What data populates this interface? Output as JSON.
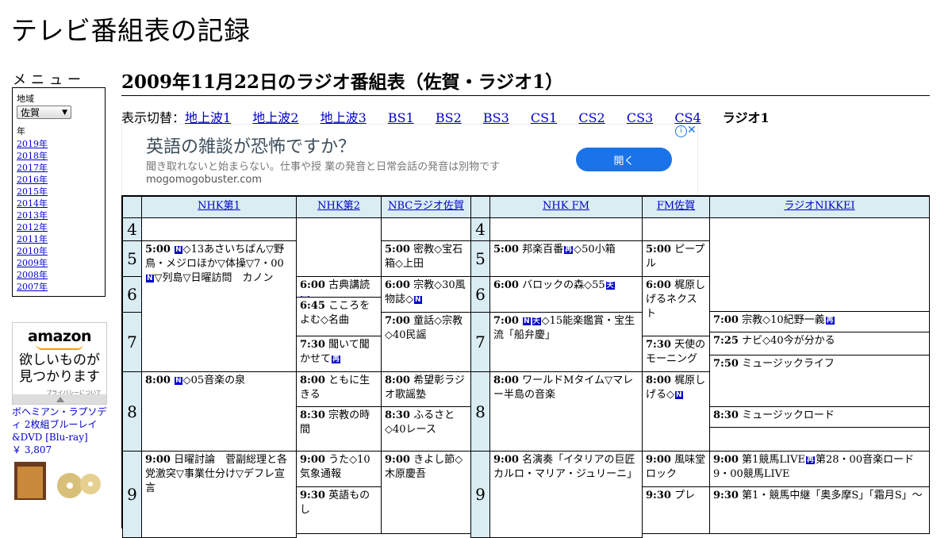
{
  "site": {
    "title": "テレビ番組表の記録"
  },
  "sidebar": {
    "menu_heading": "メニュー",
    "region_label": "地域",
    "region_value": "佐賀",
    "year_label": "年",
    "years": [
      "2019年",
      "2018年",
      "2017年",
      "2016年",
      "2015年",
      "2014年",
      "2013年",
      "2012年",
      "2011年",
      "2010年",
      "2009年",
      "2008年",
      "2007年"
    ]
  },
  "amazon_ad": {
    "logo": "amazon",
    "copy_line1": "欲しいものが",
    "copy_line2": "見つかります",
    "privacy": "プライバシーについて",
    "product_title": "ボヘミアン・ラプソディ 2枚組ブルーレイ&DVD [Blu-ray]",
    "product_price": "￥ 3,807"
  },
  "page": {
    "title": "2009年11月22日のラジオ番組表（佐賀・ラジオ1）"
  },
  "switcher": {
    "label": "表示切替：",
    "links": [
      "地上波1",
      "地上波2",
      "地上波3",
      "BS1",
      "BS2",
      "BS3",
      "CS1",
      "CS2",
      "CS3",
      "CS4"
    ],
    "current": "ラジオ1"
  },
  "banner_ad": {
    "headline": "英語の雑談が恐怖ですか？",
    "description": "聞き取れないと始まらない。仕事や授 業の発音と日常会話の発音は別物です",
    "domain": "mogomogobuster.com",
    "button": "開く",
    "info_icon": "i",
    "close_icon": "✕"
  },
  "schedule": {
    "channels": [
      "NHK第1",
      "NHK第2",
      "NBCラジオ佐賀",
      "NHK FM",
      "FM佐賀",
      "ラジオNIKKEI"
    ],
    "hours": [
      "4",
      "5",
      "6",
      "7",
      "8",
      "9"
    ],
    "programs": {
      "nhk1_500": {
        "time": "5:00",
        "text": "◇13あさいちばん▽野鳥・メジロほか▽体操▽7・00",
        "tail": "▽列島▽日曜訪問　カノン"
      },
      "nhk1_800": {
        "time": "8:00",
        "text": "◇05音楽の泉"
      },
      "nhk1_900": {
        "time": "9:00",
        "text": "日曜討論　菅副総理と各党激突▽事業仕分け▽デフレ宣言"
      },
      "nhk2_600": {
        "time": "6:00",
        "text": "古典講読"
      },
      "nhk2_645": {
        "time": "6:45",
        "text": "こころをよむ◇名曲"
      },
      "nhk2_730": {
        "time": "7:30",
        "text": "聞いて聞かせて"
      },
      "nhk2_800": {
        "time": "8:00",
        "text": "ともに生きる"
      },
      "nhk2_830": {
        "time": "8:30",
        "text": "宗教の時間"
      },
      "nhk2_900": {
        "time": "9:00",
        "text": "うた◇10気象通報"
      },
      "nhk2_930": {
        "time": "9:30",
        "text": "英語ものし"
      },
      "nbc_500": {
        "time": "5:00",
        "text": "密教◇宝石箱◇上田"
      },
      "nbc_600": {
        "time": "6:00",
        "text": "宗教◇30風物誌◇"
      },
      "nbc_700": {
        "time": "7:00",
        "text": "童話◇宗教◇40民謡"
      },
      "nbc_800": {
        "time": "8:00",
        "text": "希望彰ラジオ歌謡塾"
      },
      "nbc_830": {
        "time": "8:30",
        "text": "ふるさと◇40レース"
      },
      "nbc_900": {
        "time": "9:00",
        "text": "きよし節◇木原慶吾"
      },
      "fm_500": {
        "time": "5:00",
        "text": "邦楽百番",
        "tail": "◇50小箱"
      },
      "fm_600": {
        "time": "6:00",
        "text": "バロックの森◇55"
      },
      "fm_700": {
        "time": "7:00",
        "text": "◇15能楽鑑賞・宝生流「船弁慶」"
      },
      "fm_800": {
        "time": "8:00",
        "text": "ワールドMタイム▽マレー半島の音楽"
      },
      "fm_900": {
        "time": "9:00",
        "text": "名演奏「イタリアの巨匠カルロ・マリア・ジュリーニ」"
      },
      "fmsaga_500": {
        "time": "5:00",
        "text": "ピープル"
      },
      "fmsaga_600": {
        "time": "6:00",
        "text": "梶原しげるネクスト"
      },
      "fmsaga_730": {
        "time": "7:30",
        "text": "天使のモーニング"
      },
      "fmsaga_800": {
        "time": "8:00",
        "text": "梶原しげる◇"
      },
      "fmsaga_900": {
        "time": "9:00",
        "text": "風味堂ロック"
      },
      "fmsaga_930": {
        "time": "9:30",
        "text": "プレ"
      },
      "nikkei_700": {
        "time": "7:00",
        "text": "宗教◇10紀野一義"
      },
      "nikkei_725": {
        "time": "7:25",
        "text": "ナビ◇40今が分かる"
      },
      "nikkei_750": {
        "time": "7:50",
        "text": "ミュージックライフ"
      },
      "nikkei_830": {
        "time": "8:30",
        "text": "ミュージックロード"
      },
      "nikkei_900": {
        "time": "9:00",
        "text": "第1競馬LIVE",
        "tail": "第28・00音楽ロード9・00競馬LIVE"
      },
      "nikkei_930": {
        "time": "9:30",
        "text": "第1・競馬中継「奥多摩S」「霜月S」～"
      }
    },
    "marks": {
      "news": "N",
      "rebroadcast": "再",
      "weather": "天"
    }
  }
}
